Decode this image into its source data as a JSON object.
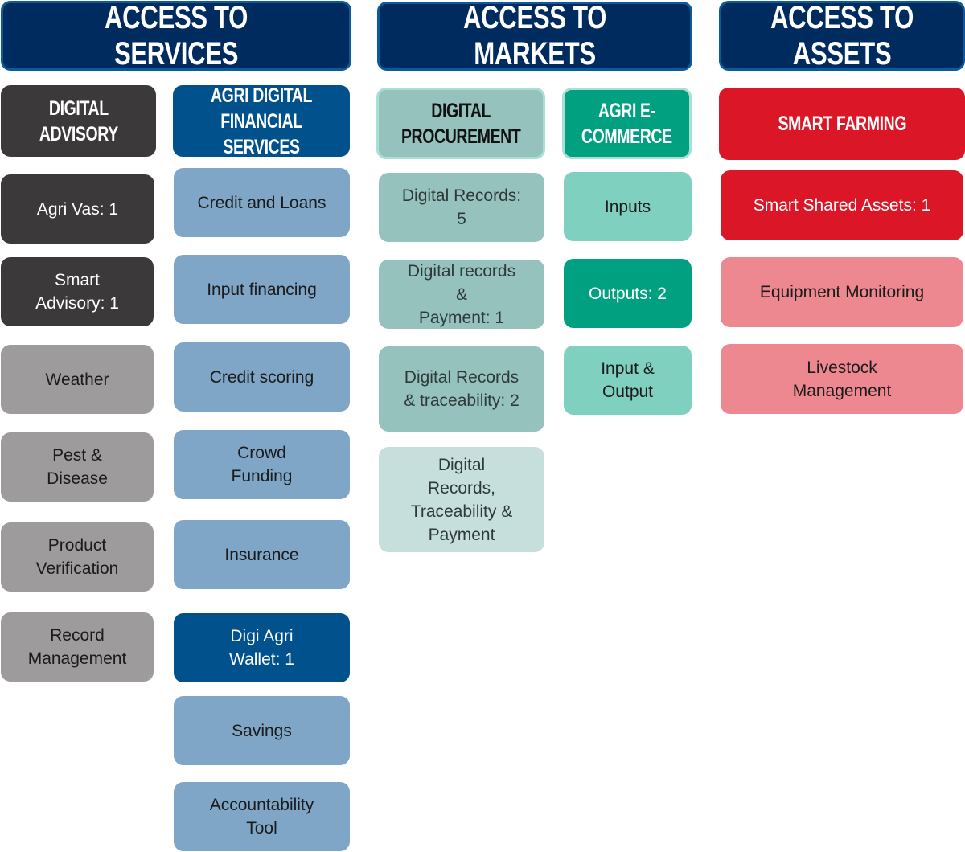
{
  "columns": [
    {
      "title": "ACCESS TO SERVICES",
      "groups": [
        {
          "title": "DIGITAL\nADVISORY",
          "items": [
            "Agri Vas: 1",
            "Smart\nAdvisory: 1",
            "Weather",
            "Pest &\nDisease",
            "Product\nVerification",
            "Record\nManagement"
          ]
        },
        {
          "title": "AGRI DIGITAL\nFINANCIAL SERVICES",
          "items": [
            "Credit and Loans",
            "Input financing",
            "Credit scoring",
            "Crowd\nFunding",
            "Insurance",
            "Digi Agri\nWallet: 1",
            "Savings",
            "Accountability\nTool"
          ]
        }
      ]
    },
    {
      "title": "ACCESS TO MARKETS",
      "groups": [
        {
          "title": "DIGITAL\nPROCUREMENT",
          "items": [
            "Digital Records:\n5",
            "Digital records\n&\nPayment: 1",
            "Digital Records\n& traceability: 2",
            "Digital\nRecords,\nTraceability &\nPayment"
          ]
        },
        {
          "title": "AGRI E-\nCOMMERCE",
          "items": [
            "Inputs",
            "Outputs: 2",
            "Input &\nOutput"
          ]
        }
      ]
    },
    {
      "title": "ACCESS TO ASSETS",
      "groups": [
        {
          "title": "SMART FARMING",
          "items": [
            "Smart Shared Assets: 1",
            "Equipment Monitoring",
            "Livestock\nManagement"
          ]
        }
      ]
    }
  ]
}
